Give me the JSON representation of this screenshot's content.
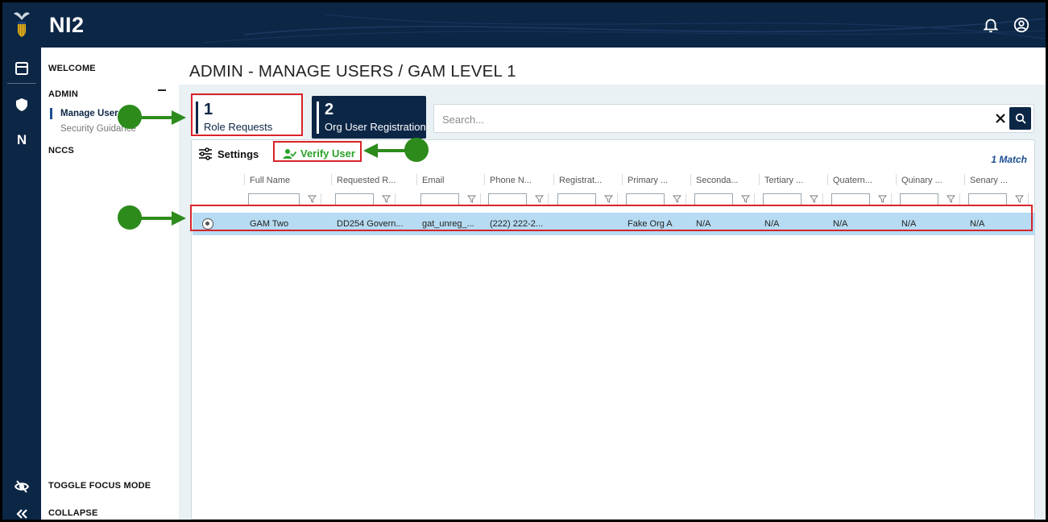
{
  "app": {
    "title": "NI2"
  },
  "sidebar": {
    "welcome": "WELCOME",
    "admin": "ADMIN",
    "admin_items": [
      {
        "label": "Manage Users",
        "active": true
      },
      {
        "label": "Security Guidance",
        "active": false
      }
    ],
    "nccs": "NCCS",
    "toggle_focus": "TOGGLE FOCUS MODE",
    "collapse": "COLLAPSE",
    "rail_letter": "N"
  },
  "page": {
    "title": "ADMIN - MANAGE USERS / GAM LEVEL 1"
  },
  "tabs": [
    {
      "num": "1",
      "label": "Role Requests"
    },
    {
      "num": "2",
      "label": "Org User Registration"
    }
  ],
  "search": {
    "placeholder": "Search..."
  },
  "toolbar": {
    "settings": "Settings",
    "verify_user": "Verify User",
    "match_count": "1 Match"
  },
  "table": {
    "columns": [
      "Full Name",
      "Requested R...",
      "Email",
      "Phone N...",
      "Registrat...",
      "Primary ...",
      "Seconda...",
      "Tertiary ...",
      "Quatern...",
      "Quinary ...",
      "Senary ..."
    ],
    "rows": [
      {
        "selected": true,
        "cells": [
          "GAM Two",
          "DD254 Govern...",
          "gat_unreg_...",
          "(222) 222-2...",
          "",
          "Fake Org A",
          "N/A",
          "N/A",
          "N/A",
          "N/A",
          "N/A"
        ]
      }
    ]
  },
  "colors": {
    "navy": "#0c2646",
    "panel_bg": "#e9f1f4",
    "selected_row": "#b6dbf2",
    "verify_green": "#2aa12a",
    "annotation_red": "#d9232a",
    "annotation_green": "#2d8b1c"
  },
  "icons": {
    "top": [
      "bell-icon",
      "account-circle-icon"
    ],
    "rail": [
      "dashboard-icon",
      "shield-icon",
      "eye-off-icon",
      "double-chevron-left-icon"
    ]
  }
}
